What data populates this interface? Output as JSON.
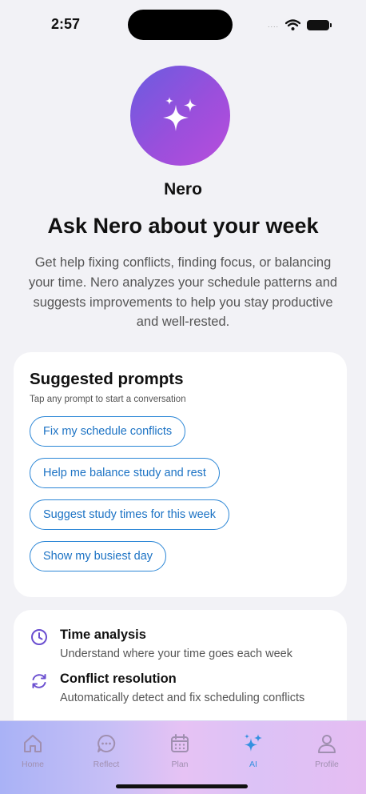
{
  "status_bar": {
    "time": "2:57",
    "signal": "....",
    "icons": [
      "wifi-icon",
      "battery-icon"
    ]
  },
  "assistant": {
    "name": "Nero",
    "icon": "sparkles-icon",
    "gradient": [
      "#6a5ce0",
      "#b84ddb"
    ]
  },
  "hero": {
    "title": "Ask Nero about your week",
    "subtitle": "Get help fixing conflicts, finding focus, or balancing your time. Nero analyzes your schedule patterns and suggests improvements to help you stay productive and well-rested."
  },
  "prompts": {
    "title": "Suggested prompts",
    "hint": "Tap any prompt to start a conversation",
    "items": [
      {
        "label": "Fix my schedule conflicts"
      },
      {
        "label": "Help me balance study and rest"
      },
      {
        "label": "Suggest study times for this week"
      },
      {
        "label": "Show my busiest day"
      }
    ]
  },
  "features": [
    {
      "icon": "clock-icon",
      "title": "Time analysis",
      "description": "Understand where your time goes each week"
    },
    {
      "icon": "refresh-icon",
      "title": "Conflict resolution",
      "description": "Automatically detect and fix scheduling conflicts"
    }
  ],
  "tab_bar": {
    "tabs": [
      {
        "label": "Home",
        "icon": "home-icon",
        "active": false
      },
      {
        "label": "Reflect",
        "icon": "chat-bubble-icon",
        "active": false
      },
      {
        "label": "Plan",
        "icon": "calendar-icon",
        "active": false
      },
      {
        "label": "AI",
        "icon": "sparkles-icon",
        "active": true
      },
      {
        "label": "Profile",
        "icon": "person-icon",
        "active": false
      }
    ]
  },
  "colors": {
    "accent": "#2b86d6",
    "active_tab": "#3490e0",
    "feature_icon": "#6b4fd0"
  }
}
